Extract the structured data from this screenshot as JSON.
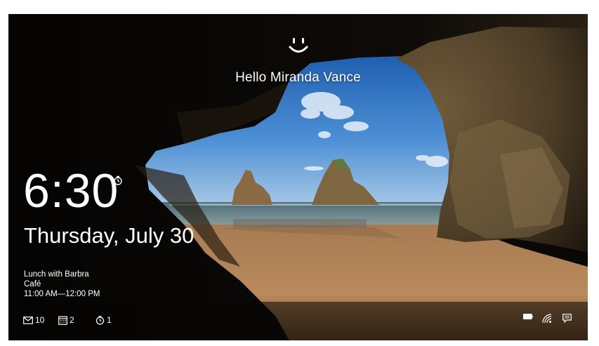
{
  "lock_screen": {
    "greeting": "Hello Miranda Vance",
    "clock": {
      "time": "6:30",
      "date": "Thursday, July 30"
    },
    "calendar_event": {
      "title": "Lunch with Barbra",
      "location": "Café",
      "time_range": "11:00 AM—12:00 PM"
    },
    "notifications": [
      {
        "icon": "mail-icon",
        "count": "10"
      },
      {
        "icon": "calendar-icon",
        "count": "2"
      },
      {
        "icon": "alarm-icon",
        "count": "1"
      }
    ],
    "system_tray": [
      "battery-icon",
      "wifi-icon",
      "action-center-icon"
    ],
    "colors": {
      "text": "#ffffff",
      "sky": "#3a7fc8",
      "sand": "#b8875a",
      "cave": "#1a140e"
    }
  }
}
